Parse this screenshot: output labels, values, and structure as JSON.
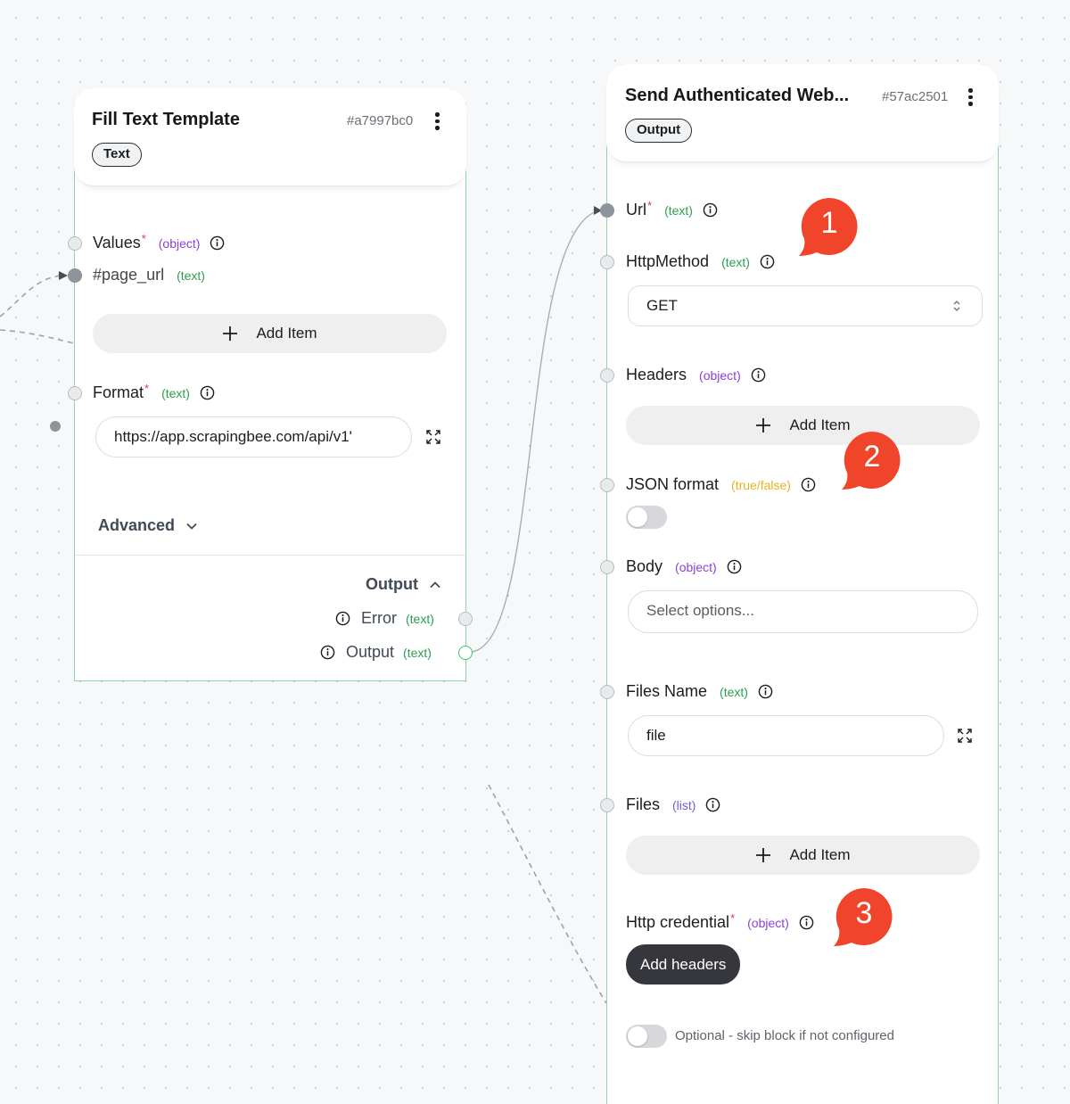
{
  "node_fill": {
    "title": "Fill Text Template",
    "id": "#a7997bc0",
    "tag": "Text",
    "values": {
      "label": "Values",
      "required": "*",
      "type": "(object)"
    },
    "page_url": {
      "label": "#page_url",
      "type": "(text)"
    },
    "add_item": "Add Item",
    "format": {
      "label": "Format",
      "required": "*",
      "type": "(text)",
      "value": "https://app.scrapingbee.com/api/v1'"
    },
    "advanced": "Advanced",
    "output_section": "Output",
    "outputs": [
      {
        "label": "Error",
        "type": "(text)"
      },
      {
        "label": "Output",
        "type": "(text)"
      }
    ]
  },
  "node_send": {
    "title": "Send Authenticated Web...",
    "id": "#57ac2501",
    "tag": "Output",
    "url": {
      "label": "Url",
      "required": "*",
      "type": "(text)"
    },
    "http_method": {
      "label": "HttpMethod",
      "type": "(text)",
      "value": "GET"
    },
    "headers": {
      "label": "Headers",
      "type": "(object)",
      "add_item": "Add Item"
    },
    "json_format": {
      "label": "JSON format",
      "type": "(true/false)"
    },
    "body": {
      "label": "Body",
      "type": "(object)",
      "placeholder": "Select options..."
    },
    "files_name": {
      "label": "Files Name",
      "type": "(text)",
      "value": "file"
    },
    "files": {
      "label": "Files",
      "type": "(list)",
      "add_item": "Add Item"
    },
    "http_credential": {
      "label": "Http credential",
      "required": "*",
      "type": "(object)",
      "button": "Add headers"
    },
    "optional": "Optional - skip block if not configured"
  },
  "badges": [
    "1",
    "2",
    "3"
  ],
  "colors": {
    "node_border": "#8fd6a6",
    "badge": "#f0452a",
    "object_type": "#8a42d8",
    "text_type": "#2f9d4f",
    "bool_type": "#e6b21c",
    "required": "#e0394b"
  }
}
